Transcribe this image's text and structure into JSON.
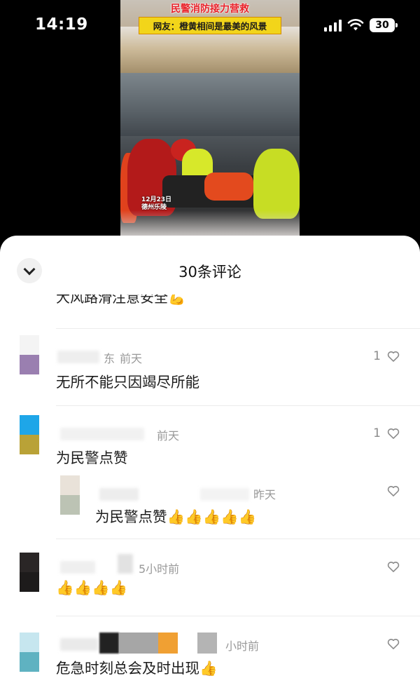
{
  "status_bar": {
    "time": "14:19",
    "battery": "30"
  },
  "video": {
    "title": "民警消防接力营救",
    "subtitle": "网友：橙黄相间是最美的风景",
    "stamp_date": "12月23日",
    "stamp_place": "德州乐陵"
  },
  "sheet": {
    "title": "30条评论",
    "cut_comment": "大风路滑注意安全💪"
  },
  "comments": [
    {
      "author_suffix": "东",
      "time": "前天",
      "text": "无所不能只因竭尽所能",
      "likes": "1"
    },
    {
      "author_suffix": "",
      "time": "前天",
      "text": "为民警点赞",
      "likes": "1"
    },
    {
      "author_suffix": "",
      "time": "昨天",
      "text": "为民警点赞👍👍👍👍👍",
      "likes": ""
    },
    {
      "author_suffix": "",
      "time": "5小时前",
      "text": "👍👍👍👍",
      "likes": ""
    },
    {
      "author_suffix": "",
      "time": "小时前",
      "text": "危急时刻总会及时出现👍",
      "likes": ""
    }
  ],
  "colors": {
    "sheet_bg": "#ffffff",
    "meta_text": "#999999",
    "heart": "#8a8a8a",
    "avatar_1_top": "#f4f4f4",
    "avatar_1_bottom": "#9a7fb0",
    "avatar_2_top": "#1ea6e8",
    "avatar_2_bottom": "#b9a237",
    "avatar_3_top": "#e9e2d9",
    "avatar_3_bottom": "#bcc3b4",
    "avatar_4_top": "#2a2626",
    "avatar_4_bottom": "#1d1b1b",
    "avatar_5_top": "#c6e6ef",
    "avatar_5_bottom": "#5fb2c1"
  },
  "icons": [
    "chevron-down-icon",
    "heart-icon",
    "signal-icon",
    "wifi-icon",
    "battery-icon"
  ]
}
